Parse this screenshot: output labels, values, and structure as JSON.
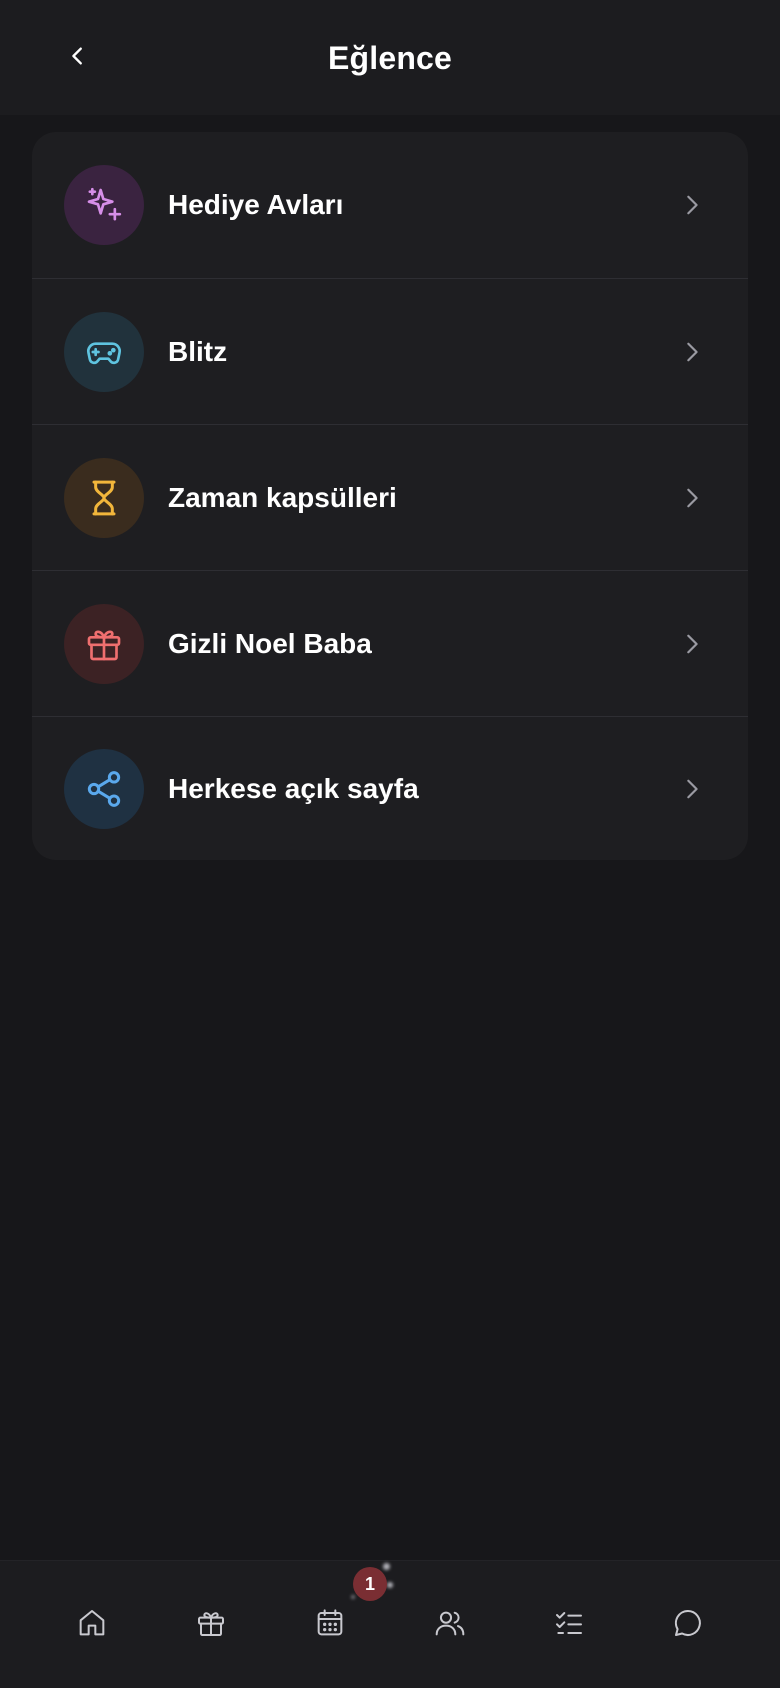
{
  "header": {
    "title": "Eğlence",
    "back_icon": "chevron-left-icon"
  },
  "menu": {
    "items": [
      {
        "label": "Hediye Avları",
        "icon": "sparkles-icon",
        "icon_color": "#d68ee8",
        "icon_bg": "#3a2340"
      },
      {
        "label": "Blitz",
        "icon": "gamepad-icon",
        "icon_color": "#5fc4e0",
        "icon_bg": "#21323c"
      },
      {
        "label": "Zaman kapsülleri",
        "icon": "hourglass-icon",
        "icon_color": "#f2b63b",
        "icon_bg": "#3a2c1e"
      },
      {
        "label": "Gizli Noel Baba",
        "icon": "gift-icon",
        "icon_color": "#ef6f6f",
        "icon_bg": "#3c2224"
      },
      {
        "label": "Herkese açık sayfa",
        "icon": "share-icon",
        "icon_color": "#5aa8ec",
        "icon_bg": "#1f3142"
      }
    ],
    "chevron_icon": "chevron-right-icon",
    "chevron_color": "#9a9aa2"
  },
  "tabbar": {
    "icons": [
      "home-icon",
      "gift-icon",
      "calendar-icon",
      "users-icon",
      "checklist-icon",
      "chat-icon"
    ],
    "icon_color": "#c9c9cf",
    "badge_count": "1",
    "badge_color": "#7a2e33"
  }
}
